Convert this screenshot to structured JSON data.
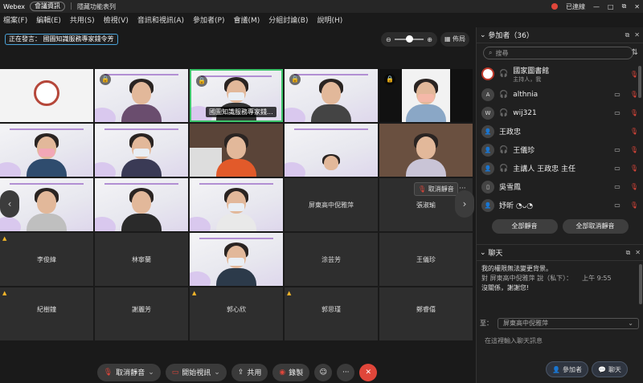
{
  "titlebar": {
    "brand": "Webex",
    "meeting_info": "會議資訊",
    "hide_menu": "隱藏功能表列",
    "status": "已連線",
    "minimize": "—",
    "maximize": "□",
    "restore": "⧉",
    "close": "✕"
  },
  "menu": [
    "檔案(F)",
    "編輯(E)",
    "共用(S)",
    "檢視(V)",
    "音訊和視訊(A)",
    "參加者(P)",
    "會議(M)",
    "分組討論(B)",
    "說明(H)"
  ],
  "speaking": "正在發言： 國圖知識服務專家錢令芳",
  "layout_label": "佈局",
  "tiles": {
    "name_overlay": "國圖知識服務專家錢...",
    "unmute_btn": "取消靜音",
    "names": [
      "屏東高中倪雅萍",
      "張淑瑜",
      "李俊緯",
      "林寧蘭",
      "涂芸芳",
      "王儀珍",
      "紀樹鐘",
      "謝麗芳",
      "郭心欣",
      "郭思瑾",
      "鄭睿僖"
    ]
  },
  "controls": {
    "mute": "取消靜音",
    "video": "開始視訊",
    "share": "共用",
    "record": "錄製"
  },
  "participants": {
    "title": "參加者（36）",
    "search_placeholder": "搜尋",
    "list": [
      {
        "avatar": "",
        "name": "國家圖書館",
        "sub": "主持人，我"
      },
      {
        "avatar": "A",
        "name": "althnia",
        "sub": ""
      },
      {
        "avatar": "W",
        "name": "wij321",
        "sub": ""
      },
      {
        "avatar": "",
        "name": "王政忠",
        "sub": ""
      },
      {
        "avatar": "",
        "name": "王儀珍",
        "sub": ""
      },
      {
        "avatar": "",
        "name": "主講人 王政忠 主任",
        "sub": ""
      },
      {
        "avatar": "",
        "name": "吳雪鳳",
        "sub": ""
      },
      {
        "avatar": "",
        "name": "妤昕 ◔ᴗ◔",
        "sub": ""
      }
    ],
    "mute_all": "全部靜音",
    "unmute_all": "全部取消靜音"
  },
  "chat": {
    "title": "聊天",
    "system_msg": "我的權限無法變更背景。",
    "from_meta": "對 屏東高中倪雅萍 說（私下）：",
    "time": "上午 9:55",
    "message": "沒關係，謝謝您!",
    "to_label": "至：",
    "to_value": "屏東高中倪雅萍",
    "input_placeholder": "在這裡輸入聊天訊息"
  },
  "bottom_tabs": {
    "participants": "參加者",
    "chat": "聊天"
  },
  "colors": {
    "accent": "#4aa3d9",
    "danger": "#e0463a",
    "warn": "#f0b429"
  }
}
